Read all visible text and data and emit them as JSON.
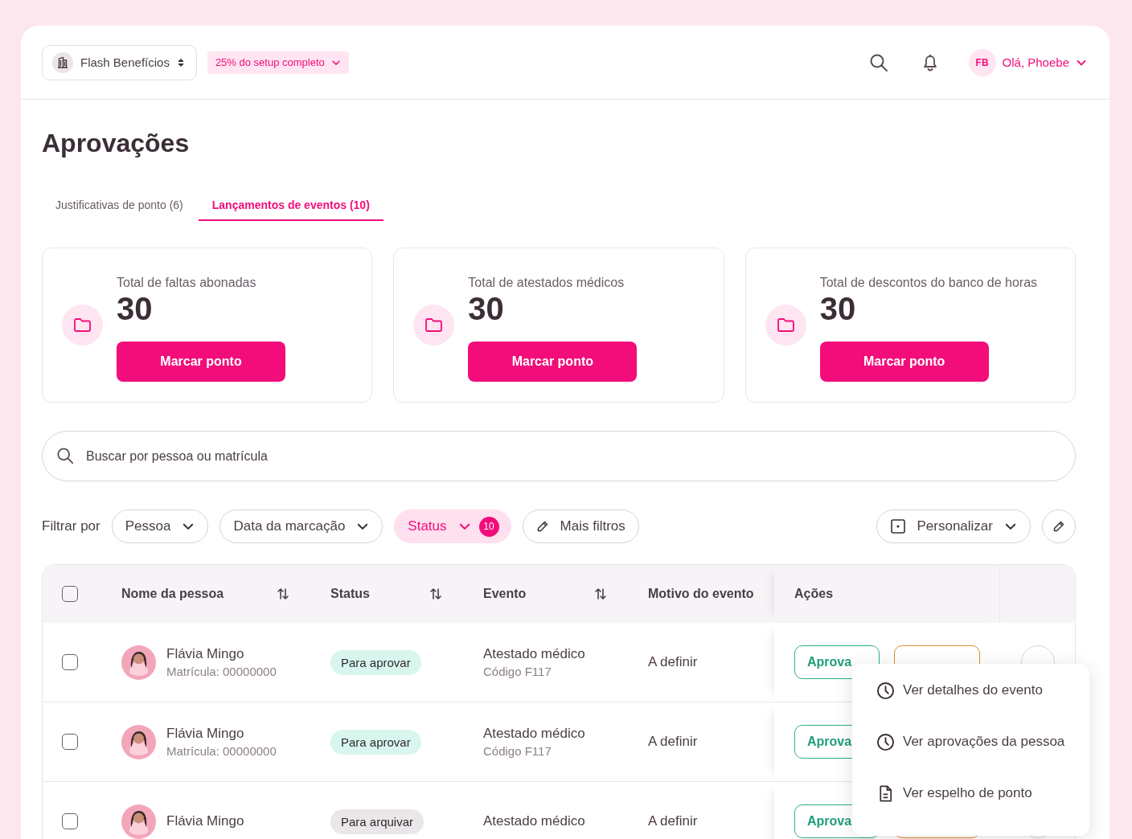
{
  "header": {
    "company": "Flash Benefícios",
    "setup_progress": "25% do setup completo",
    "user_initials": "FB",
    "greeting": "Olá, Phoebe"
  },
  "page_title": "Aprovações",
  "tabs": [
    {
      "label": "Justificativas de ponto (6)",
      "selected": false
    },
    {
      "label": "Lançamentos de eventos (10)",
      "selected": true
    }
  ],
  "cards": [
    {
      "title": "Total de faltas abonadas",
      "value": "30",
      "button": "Marcar ponto"
    },
    {
      "title": "Total de atestados médicos",
      "value": "30",
      "button": "Marcar ponto"
    },
    {
      "title": "Total de descontos do banco de horas",
      "value": "30",
      "button": "Marcar ponto"
    }
  ],
  "search": {
    "placeholder": "Buscar por pessoa ou matrícula"
  },
  "filters": {
    "label": "Filtrar por",
    "items": [
      {
        "label": "Pessoa",
        "kind": "dropdown",
        "active": false
      },
      {
        "label": "Data da marcação",
        "kind": "dropdown",
        "active": false
      },
      {
        "label": "Status",
        "kind": "dropdown",
        "active": true,
        "count": "10"
      },
      {
        "label": "Mais filtros",
        "kind": "edit",
        "active": false
      }
    ],
    "customize": "Personalizar"
  },
  "table": {
    "select_all_checked": false,
    "columns": [
      {
        "label": "Nome da pessoa",
        "sortable": true
      },
      {
        "label": "Status",
        "sortable": true
      },
      {
        "label": "Evento",
        "sortable": true
      },
      {
        "label": "Motivo do evento",
        "sortable": false
      },
      {
        "label": "Ações",
        "sortable": false
      }
    ],
    "rows": [
      {
        "checked": false,
        "name": "Flávia Mingo",
        "registration": "Matrícula: 00000000",
        "status": {
          "label": "Para aprovar",
          "color": "#d8f6ee"
        },
        "event": "Atestado médico",
        "code": "Código F117",
        "reason": "A definir",
        "approve": "Aprova"
      },
      {
        "checked": false,
        "name": "Flávia Mingo",
        "registration": "Matrícula: 00000000",
        "status": {
          "label": "Para aprovar",
          "color": "#d8f6ee"
        },
        "event": "Atestado médico",
        "code": "Código F117",
        "reason": "A definir",
        "approve": "Aprova"
      },
      {
        "checked": false,
        "name": "Flávia Mingo",
        "status": {
          "label": "Para arquivar",
          "color": "#ebe6e9"
        },
        "event": "Atestado médico",
        "reason": "A definir",
        "approve": "Aprova"
      }
    ]
  },
  "menu": {
    "items": [
      {
        "label": "Ver detalhes do evento",
        "kind": "clock"
      },
      {
        "label": "Ver aprovações da pessoa",
        "kind": "clock"
      },
      {
        "label": "Ver espelho de ponto",
        "kind": "document"
      }
    ]
  }
}
